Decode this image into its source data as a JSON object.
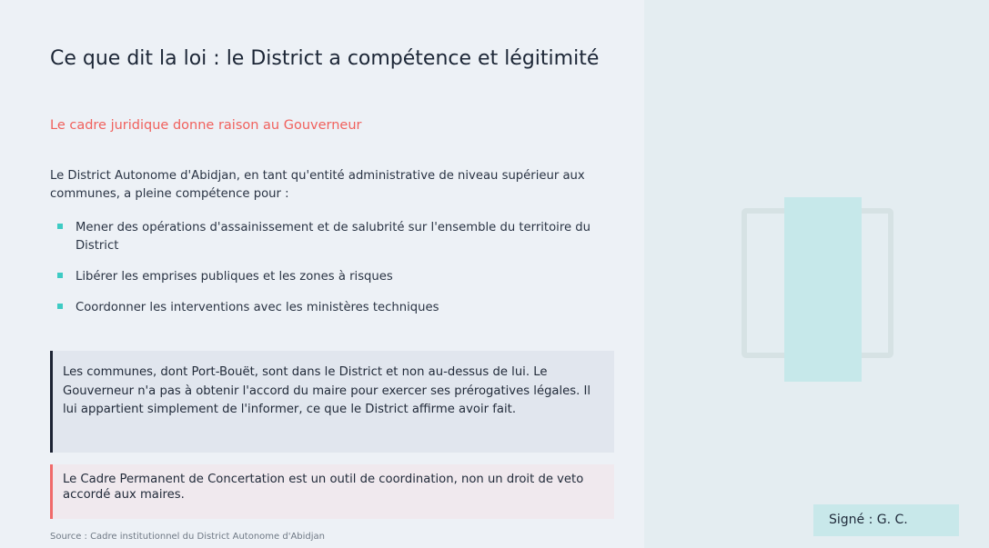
{
  "slide": {
    "title": "Ce que dit la loi : le District a compétence et légitimité",
    "subtitle": "Le cadre juridique donne raison au Gouverneur",
    "intro": "Le District Autonome d'Abidjan, en tant qu'entité administrative de niveau supérieur aux communes, a pleine compétence pour :",
    "bullets": [
      "Mener des opérations d'assainissement et de salubrité sur l'ensemble du territoire du District",
      "Libérer les emprises publiques et les zones à risques",
      "Coordonner les interventions avec les ministères techniques"
    ],
    "quote": "Les communes, dont Port-Bouët, sont dans le District et non au-dessus de lui. Le Gouverneur n'a pas à obtenir l'accord du maire pour exercer ses prérogatives légales. Il lui appartient simplement de l'informer, ce que le District affirme avoir fait.",
    "note": "Le Cadre Permanent de Concertation est un outil de coordination, non un droit de veto accordé aux maires.",
    "source": "Source : Cadre institutionnel du District Autonome d'Abidjan",
    "signature": "Signé : G. C."
  },
  "colors": {
    "accent_red": "#f0615d",
    "accent_teal": "#3ecbc4",
    "quote_border": "#1c2333"
  }
}
